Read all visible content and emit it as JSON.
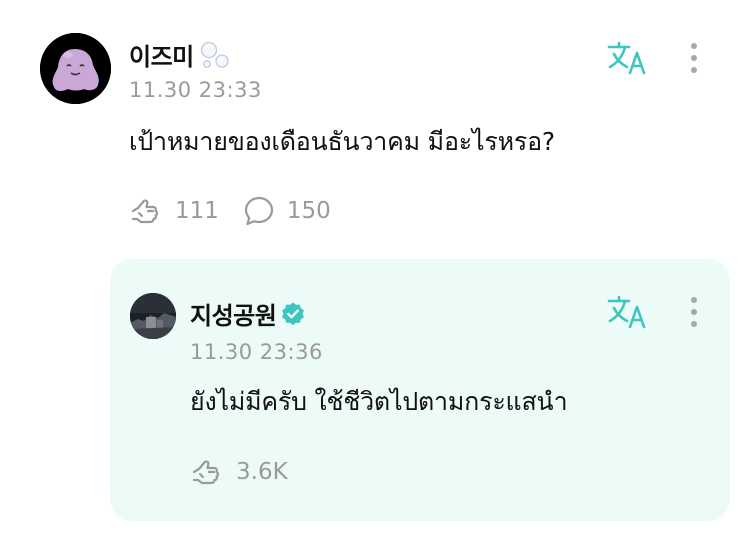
{
  "post": {
    "author": "이즈미",
    "timestamp": "11.30 23:33",
    "text": "เป้าหมายของเดือนธันวาคม มีอะไรหรอ?",
    "likes": "111",
    "comments": "150"
  },
  "reply": {
    "author": "지성공원",
    "timestamp": "11.30 23:36",
    "text": "ยังไม่มีครับ ใช้ชีวิตไปตามกระแสนำ",
    "likes": "3.6K"
  },
  "icons": {
    "translate": "translate-icon",
    "more": "more-vertical-icon",
    "like": "like-hand-icon",
    "comment": "comment-bubble-icon",
    "verified": "verified-badge-icon",
    "bubbles": "bubbles-emoji-icon"
  },
  "colors": {
    "accent": "#3cc6c0",
    "verified": "#3cc6c0",
    "reply_background": "#ecfbf8",
    "muted": "#9a9a9a"
  }
}
